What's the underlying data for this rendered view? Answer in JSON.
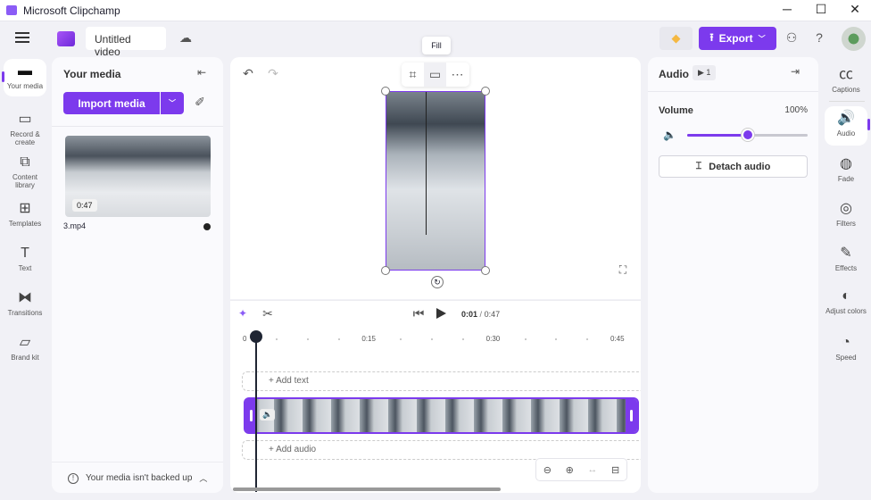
{
  "window": {
    "title": "Microsoft Clipchamp",
    "minimize": "─",
    "maximize": "☐",
    "close": "✕"
  },
  "header": {
    "project_title": "Untitled video",
    "export_label": "Export",
    "help": "?"
  },
  "left_nav": [
    {
      "label": "Your media",
      "icon": "folder-icon",
      "glyph": "▬"
    },
    {
      "label": "Record & create",
      "icon": "camera-icon",
      "glyph": "▭"
    },
    {
      "label": "Content library",
      "icon": "library-icon",
      "glyph": "⧉"
    },
    {
      "label": "Templates",
      "icon": "templates-icon",
      "glyph": "⊞"
    },
    {
      "label": "Text",
      "icon": "text-icon",
      "glyph": "T"
    },
    {
      "label": "Transitions",
      "icon": "transitions-icon",
      "glyph": "⧓"
    },
    {
      "label": "Brand kit",
      "icon": "brand-kit-icon",
      "glyph": "▱"
    }
  ],
  "media_panel": {
    "title": "Your media",
    "import_label": "Import media",
    "items": [
      {
        "name": "3.mp4",
        "duration": "0:47"
      }
    ],
    "footer": "Your media isn't backed up"
  },
  "preview": {
    "tooltip": "Fill"
  },
  "timeline": {
    "current": "0:01",
    "separator": "/",
    "total": "0:47",
    "ticks": [
      "0",
      "0:15",
      "0:30",
      "0:45"
    ],
    "add_text": "+ Add text",
    "add_audio": "+ Add audio"
  },
  "properties": {
    "title": "Audio",
    "badge": "1",
    "volume_label": "Volume",
    "volume_value": "100%",
    "volume_slider_fraction": 0.5,
    "detach_label": "Detach audio"
  },
  "right_nav": [
    {
      "label": "Captions",
      "icon": "captions-icon",
      "glyph": "㏄"
    },
    {
      "label": "Audio",
      "icon": "speaker-icon",
      "glyph": "🔊"
    },
    {
      "label": "Fade",
      "icon": "fade-icon",
      "glyph": "◍"
    },
    {
      "label": "Filters",
      "icon": "filters-icon",
      "glyph": "◎"
    },
    {
      "label": "Effects",
      "icon": "effects-icon",
      "glyph": "✎"
    },
    {
      "label": "Adjust colors",
      "icon": "adjust-colors-icon",
      "glyph": "◐"
    },
    {
      "label": "Speed",
      "icon": "speed-icon",
      "glyph": "◔"
    }
  ],
  "colors": {
    "accent": "#7c3aed"
  }
}
